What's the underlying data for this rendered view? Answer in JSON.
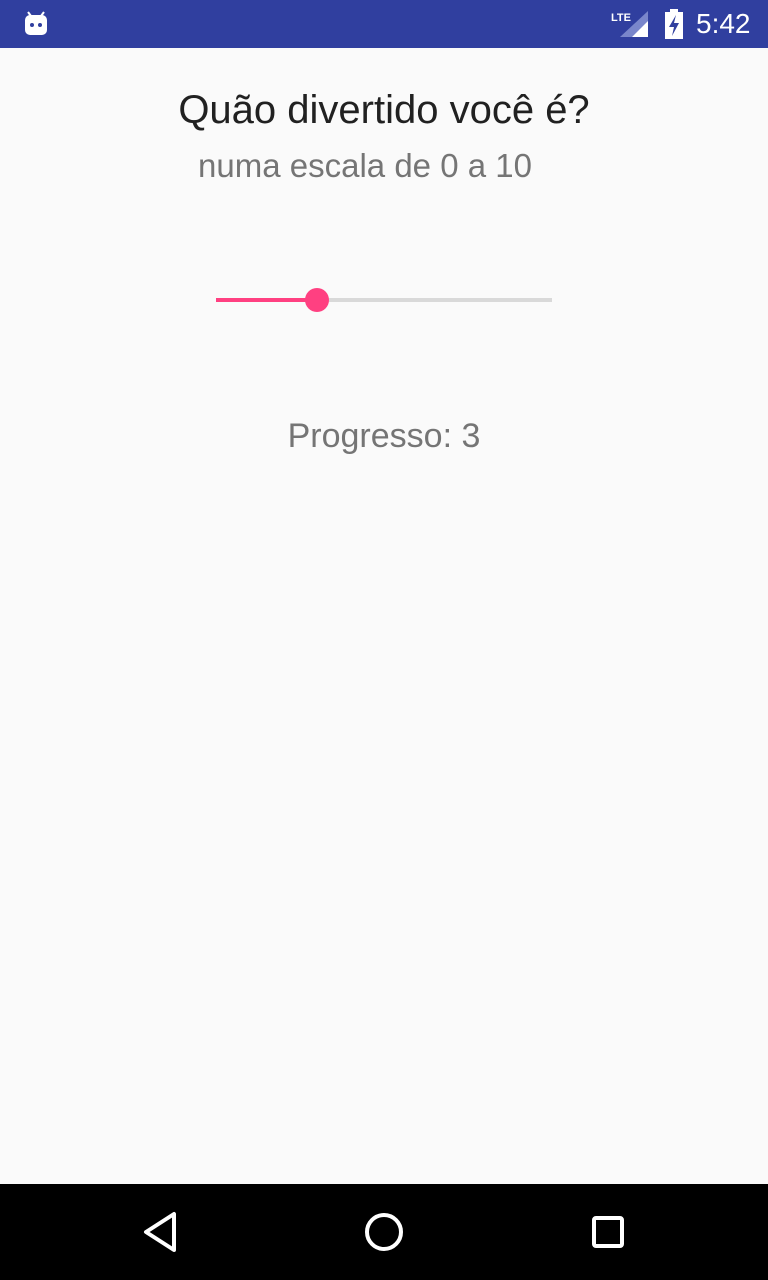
{
  "status_bar": {
    "time": "5:42",
    "network_label": "LTE",
    "app_icon": "android-robot-icon",
    "signal_icon": "cell-signal-icon",
    "battery_icon": "battery-charging-icon",
    "background_color": "#303f9f"
  },
  "main": {
    "title": "Quão divertido você é?",
    "subtitle": "numa escala de 0 a 10",
    "seekbar": {
      "min": 0,
      "max": 10,
      "value": 3,
      "accent_color": "#ff4081"
    },
    "progress_text": "Progresso: 3"
  },
  "nav_bar": {
    "back_icon": "back-triangle-icon",
    "home_icon": "home-circle-icon",
    "recents_icon": "recents-square-icon"
  }
}
